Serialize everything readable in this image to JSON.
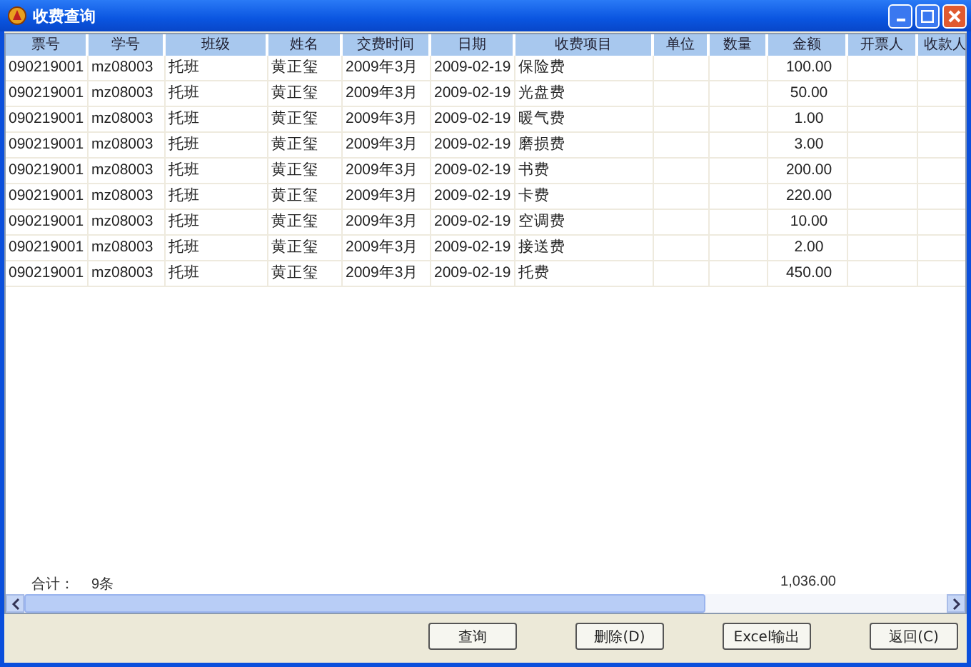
{
  "window": {
    "title": "收费查询"
  },
  "table": {
    "columns": [
      "票号",
      "学号",
      "班级",
      "姓名",
      "交费时间",
      "日期",
      "收费项目",
      "单位",
      "数量",
      "金额",
      "开票人",
      "收款人"
    ],
    "rows": [
      {
        "ticket_no": "090219001",
        "student_no": "mz08003",
        "class": "托班",
        "name": "黄正玺",
        "pay_period": "2009年3月",
        "date": "2009-02-19",
        "item": "保险费",
        "amount": "100.00"
      },
      {
        "ticket_no": "090219001",
        "student_no": "mz08003",
        "class": "托班",
        "name": "黄正玺",
        "pay_period": "2009年3月",
        "date": "2009-02-19",
        "item": "光盘费",
        "amount": "50.00"
      },
      {
        "ticket_no": "090219001",
        "student_no": "mz08003",
        "class": "托班",
        "name": "黄正玺",
        "pay_period": "2009年3月",
        "date": "2009-02-19",
        "item": "暖气费",
        "amount": "1.00"
      },
      {
        "ticket_no": "090219001",
        "student_no": "mz08003",
        "class": "托班",
        "name": "黄正玺",
        "pay_period": "2009年3月",
        "date": "2009-02-19",
        "item": "磨损费",
        "amount": "3.00"
      },
      {
        "ticket_no": "090219001",
        "student_no": "mz08003",
        "class": "托班",
        "name": "黄正玺",
        "pay_period": "2009年3月",
        "date": "2009-02-19",
        "item": "书费",
        "amount": "200.00"
      },
      {
        "ticket_no": "090219001",
        "student_no": "mz08003",
        "class": "托班",
        "name": "黄正玺",
        "pay_period": "2009年3月",
        "date": "2009-02-19",
        "item": "卡费",
        "amount": "220.00"
      },
      {
        "ticket_no": "090219001",
        "student_no": "mz08003",
        "class": "托班",
        "name": "黄正玺",
        "pay_period": "2009年3月",
        "date": "2009-02-19",
        "item": "空调费",
        "amount": "10.00"
      },
      {
        "ticket_no": "090219001",
        "student_no": "mz08003",
        "class": "托班",
        "name": "黄正玺",
        "pay_period": "2009年3月",
        "date": "2009-02-19",
        "item": "接送费",
        "amount": "2.00"
      },
      {
        "ticket_no": "090219001",
        "student_no": "mz08003",
        "class": "托班",
        "name": "黄正玺",
        "pay_period": "2009年3月",
        "date": "2009-02-19",
        "item": "托费",
        "amount": "450.00"
      }
    ]
  },
  "summary": {
    "label": "合计：",
    "count": "9条",
    "amount": "1,036.00"
  },
  "buttons": [
    "查询",
    "删除(D)",
    "Excel输出",
    "返回(C)"
  ]
}
